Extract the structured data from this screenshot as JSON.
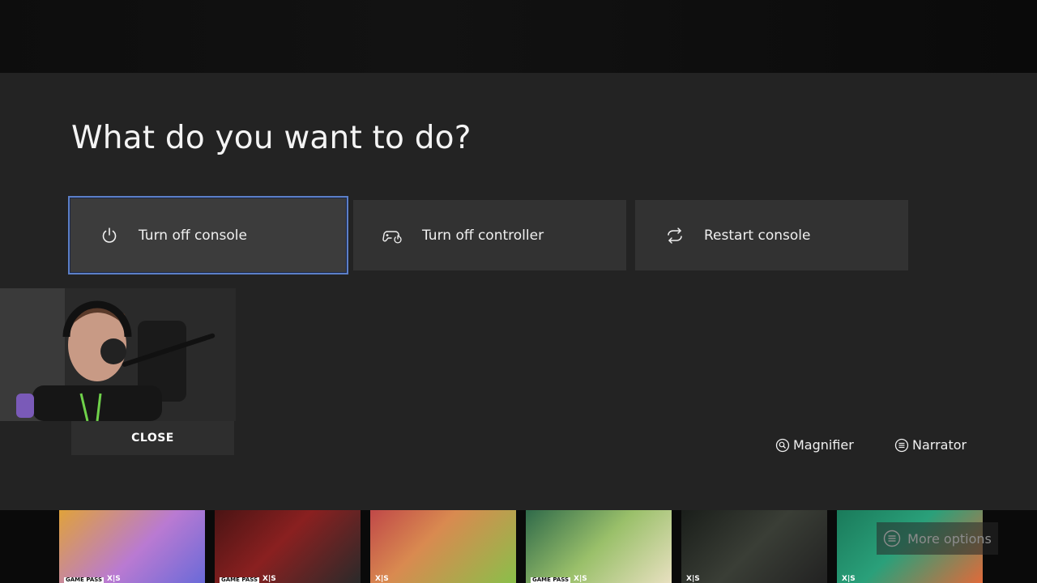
{
  "dialog": {
    "title": "What do you want to do?",
    "options": [
      {
        "label": "Turn off console",
        "icon": "power-icon",
        "focused": true
      },
      {
        "label": "Turn off controller",
        "icon": "controller-power-icon",
        "focused": false
      },
      {
        "label": "Restart console",
        "icon": "restart-icon",
        "focused": false
      }
    ]
  },
  "webcam": {
    "close_label": "CLOSE"
  },
  "accessibility": {
    "magnifier_label": "Magnifier",
    "magnifier_icon": "magnifier-icon",
    "narrator_label": "Narrator",
    "narrator_icon": "narrator-icon"
  },
  "tiles": [
    {
      "badge_gp": "GAME PASS",
      "badge_xs": "X|S"
    },
    {
      "badge_gp": "GAME PASS",
      "badge_xs": "X|S"
    },
    {
      "badge_gp": "",
      "badge_xs": "X|S"
    },
    {
      "badge_gp": "GAME PASS",
      "badge_xs": "X|S"
    },
    {
      "badge_gp": "",
      "badge_xs": "X|S"
    },
    {
      "badge_gp": "",
      "badge_xs": "X|S"
    }
  ],
  "more_options": {
    "label": "More options",
    "icon": "menu-icon"
  },
  "colors": {
    "panel": "#232323",
    "option": "#323232",
    "focus_border": "#5c7fc7"
  }
}
